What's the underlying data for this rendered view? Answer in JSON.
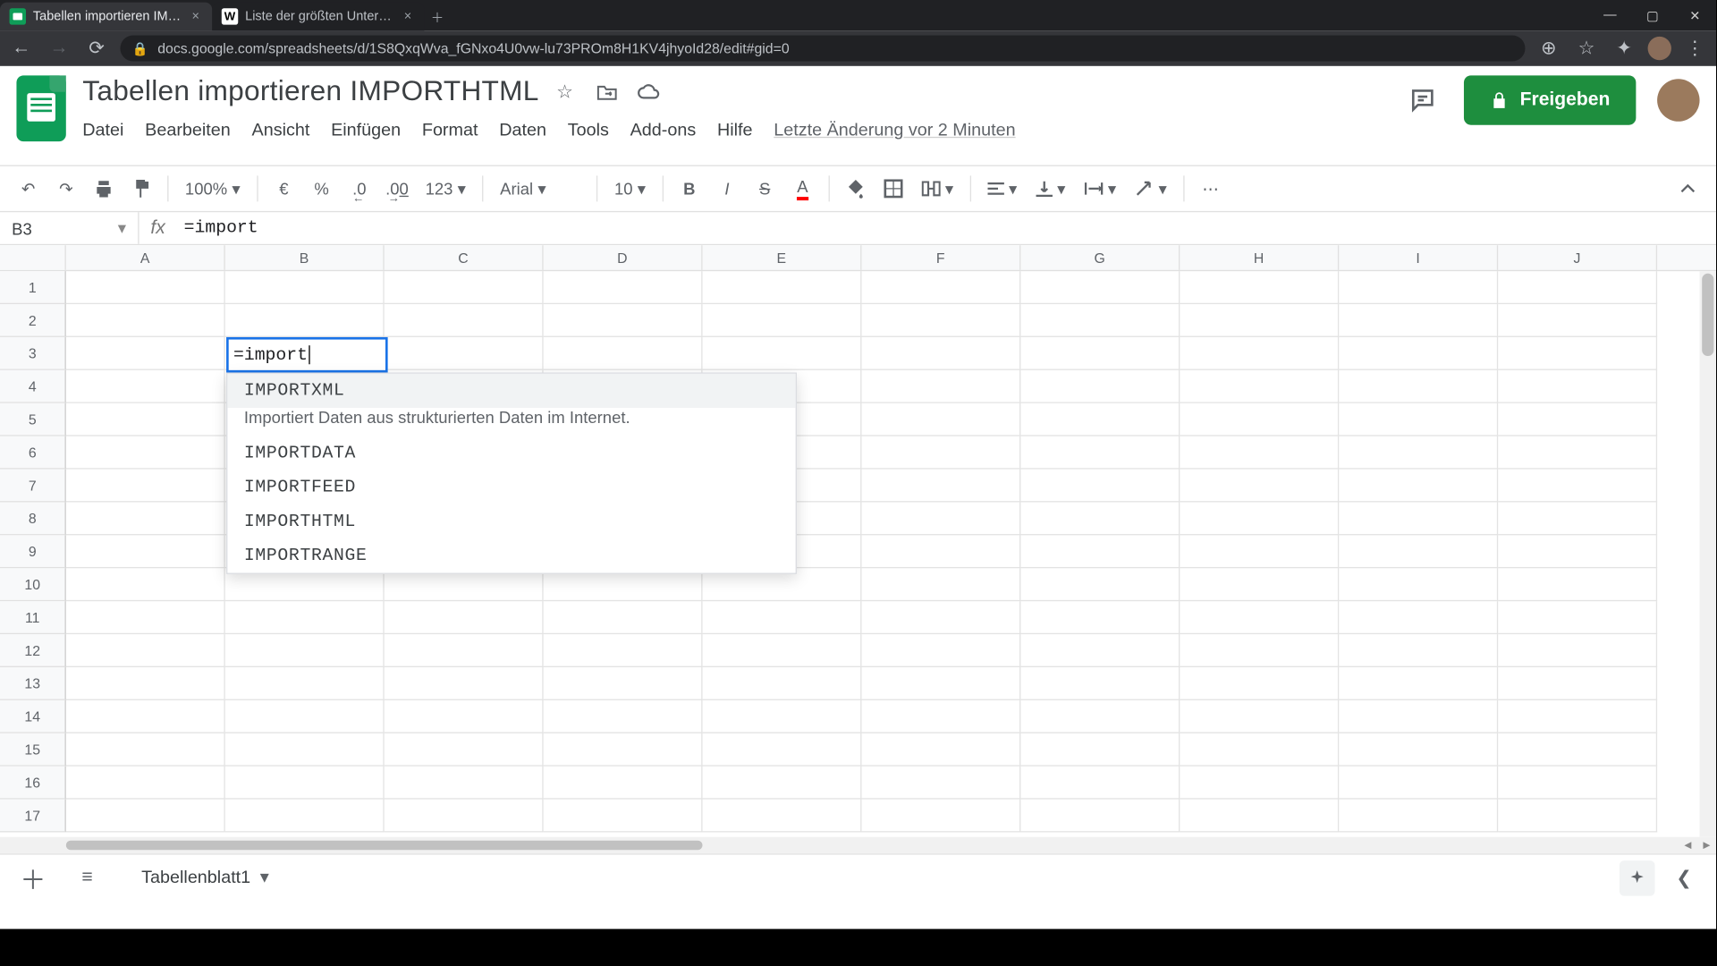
{
  "browser": {
    "tabs": [
      {
        "title": "Tabellen importieren IMPORTHTML",
        "favicon": "sheets"
      },
      {
        "title": "Liste der größten Unternehmen",
        "favicon": "wiki"
      }
    ],
    "url": "docs.google.com/spreadsheets/d/1S8QxqWva_fGNxo4U0vw-lu73PROm8H1KV4jhyoId28/edit#gid=0"
  },
  "doc": {
    "title": "Tabellen importieren IMPORTHTML",
    "menus": [
      "Datei",
      "Bearbeiten",
      "Ansicht",
      "Einfügen",
      "Format",
      "Daten",
      "Tools",
      "Add-ons",
      "Hilfe"
    ],
    "last_change": "Letzte Änderung vor 2 Minuten",
    "share_label": "Freigeben"
  },
  "toolbar": {
    "zoom": "100%",
    "currency": "€",
    "percent": "%",
    "dec_less": ".0",
    "dec_more": ".00",
    "numfmt": "123",
    "font": "Arial",
    "size": "10"
  },
  "formula": {
    "cell_ref": "B3",
    "value": "=import"
  },
  "grid": {
    "columns": [
      "A",
      "B",
      "C",
      "D",
      "E",
      "F",
      "G",
      "H",
      "I",
      "J"
    ],
    "rows": [
      "1",
      "2",
      "3",
      "4",
      "5",
      "6",
      "7",
      "8",
      "9",
      "10",
      "11",
      "12",
      "13",
      "14",
      "15",
      "16",
      "17"
    ],
    "active_cell_value": "=import"
  },
  "autocomplete": {
    "items": [
      {
        "name": "IMPORTXML",
        "desc": "Importiert Daten aus strukturierten Daten im Internet."
      },
      {
        "name": "IMPORTDATA"
      },
      {
        "name": "IMPORTFEED"
      },
      {
        "name": "IMPORTHTML"
      },
      {
        "name": "IMPORTRANGE"
      }
    ]
  },
  "footer": {
    "sheet_name": "Tabellenblatt1"
  }
}
